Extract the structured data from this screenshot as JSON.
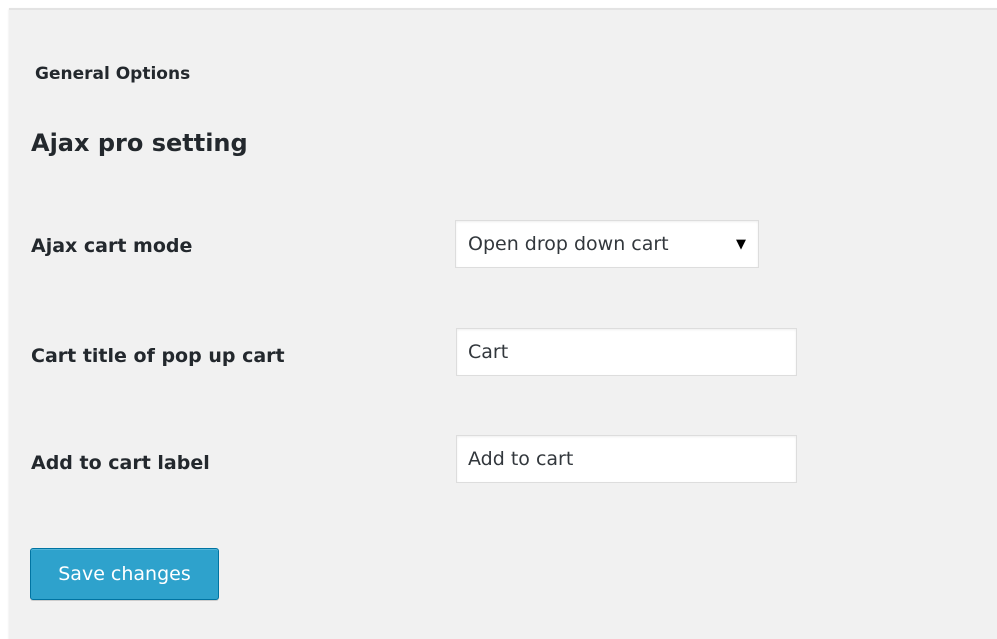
{
  "section": {
    "header": "General Options"
  },
  "settings": {
    "title": "Ajax pro setting",
    "fields": [
      {
        "label": "Ajax cart mode",
        "type": "select",
        "value": "Open drop down cart"
      },
      {
        "label": "Cart title of pop up cart",
        "type": "text",
        "value": "Cart"
      },
      {
        "label": "Add to cart label",
        "type": "text",
        "value": "Add to cart"
      }
    ],
    "save_label": "Save changes"
  },
  "icons": {
    "select_arrow": "caret-down-icon"
  },
  "colors": {
    "panel_bg": "#f1f1f1",
    "button_bg": "#2ea2cc",
    "button_border": "#0074a2",
    "text": "#23282d"
  }
}
